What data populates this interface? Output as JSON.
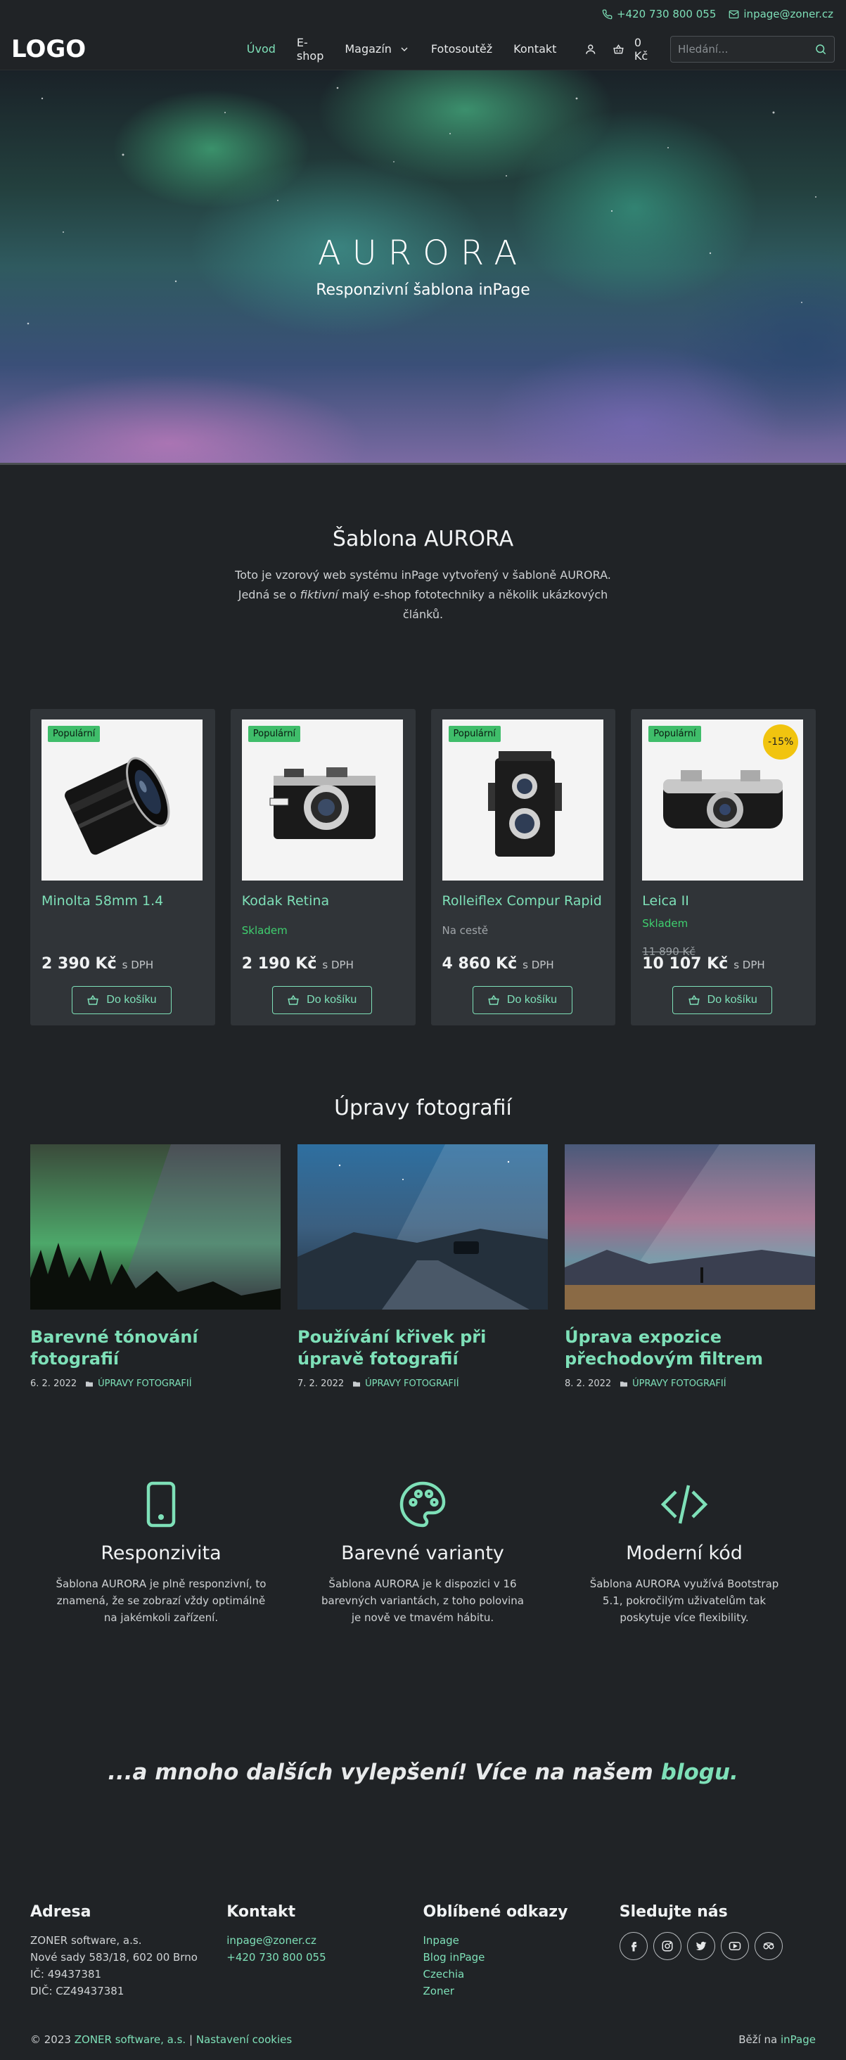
{
  "topbar": {
    "phone": "+420 730 800 055",
    "email": "inpage@zoner.cz"
  },
  "nav": {
    "logo": "LOGO",
    "links": [
      "Úvod",
      "E-shop",
      "Magazín",
      "Fotosoutěž",
      "Kontakt"
    ],
    "cart_total": "0 Kč",
    "search_placeholder": "Hledání..."
  },
  "hero": {
    "title": "AURORA",
    "subtitle": "Responzivní šablona inPage"
  },
  "intro": {
    "title": "Šablona AURORA",
    "text_before": "Toto je vzorový web systému inPage vytvořený v šabloně AURORA. Jedná se o ",
    "text_em": "fiktivní",
    "text_after": " malý e-shop fototechniky a několik ukázkových článků."
  },
  "products": [
    {
      "badge": "Populární",
      "name": "Minolta 58mm 1.4",
      "stock": "",
      "old_price": "",
      "price": "2 390 Kč",
      "vat": "s DPH",
      "button": "Do košíku"
    },
    {
      "badge": "Populární",
      "name": "Kodak Retina",
      "stock": "Skladem",
      "old_price": "",
      "price": "2 190 Kč",
      "vat": "s DPH",
      "button": "Do košíku"
    },
    {
      "badge": "Populární",
      "name": "Rolleiflex Compur Rapid",
      "stock": "Na cestě",
      "old_price": "",
      "price": "4 860 Kč",
      "vat": "s DPH",
      "button": "Do košíku"
    },
    {
      "badge": "Populární",
      "discount": "-15%",
      "name": "Leica II",
      "stock": "Skladem",
      "old_price": "11 890 Kč",
      "price": "10 107 Kč",
      "vat": "s DPH",
      "button": "Do košíku"
    }
  ],
  "articles_title": "Úpravy fotografií",
  "articles": [
    {
      "title": "Barevné tónování fotografií",
      "date": "6. 2. 2022",
      "category": "Úpravy fotografií"
    },
    {
      "title": "Používání křivek při úpravě fotografií",
      "date": "7. 2. 2022",
      "category": "Úpravy fotografií"
    },
    {
      "title": "Úprava expozice přechodovým filtrem",
      "date": "8. 2. 2022",
      "category": "Úpravy fotografií"
    }
  ],
  "features": [
    {
      "title": "Responzivita",
      "text": "Šablona AURORA je plně responzivní, to znamená, že se zobrazí vždy optimálně na jakémkoli zařízení."
    },
    {
      "title": "Barevné varianty",
      "text": "Šablona AURORA je k dispozici v 16 barevných variantách, z toho polovina je nově ve tmavém hábitu."
    },
    {
      "title": "Moderní kód",
      "text": "Šablona AURORA využívá Bootstrap 5.1, pokročilým uživatelům tak poskytuje více flexibility."
    }
  ],
  "blog_line": {
    "text": "...a mnoho dalších vylepšení! Více na našem ",
    "link": "blogu",
    "end": "."
  },
  "footer": {
    "address": {
      "title": "Adresa",
      "lines": [
        "ZONER software, a.s.",
        "Nové sady 583/18, 602 00 Brno",
        "IČ: 49437381",
        "DIČ: CZ49437381"
      ]
    },
    "contact": {
      "title": "Kontakt",
      "email": "inpage@zoner.cz",
      "phone": "+420 730 800 055"
    },
    "links": {
      "title": "Oblíbené odkazy",
      "items": [
        "Inpage",
        "Blog inPage",
        "Czechia",
        "Zoner"
      ]
    },
    "social": {
      "title": "Sledujte nás",
      "icons": [
        "facebook-icon",
        "instagram-icon",
        "twitter-icon",
        "youtube-icon",
        "tripadvisor-icon"
      ]
    }
  },
  "bottom": {
    "copyright": "© 2023",
    "company": "ZONER software, a.s.",
    "separator": "|",
    "cookies": "Nastavení cookies",
    "powered": "Běží na",
    "powered_link": "inPage"
  },
  "colors": {
    "accent": "#7ee0b8",
    "background": "#202326",
    "card": "#303438",
    "badge": "#3fbd6a",
    "discount": "#f1c40f"
  }
}
